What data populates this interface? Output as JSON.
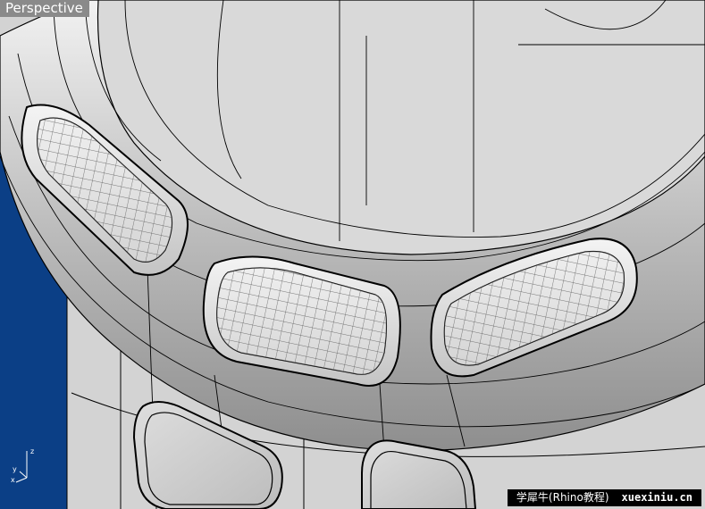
{
  "viewport": {
    "title": "Perspective"
  },
  "axis_widget": {
    "x_label": "x",
    "y_label": "y",
    "z_label": "z"
  },
  "watermark": {
    "text": "学犀牛(Rhino教程)",
    "site": "xuexiniu.cn"
  },
  "colors": {
    "background_plane": "#0b3f86",
    "model_fill": "#d8d8d8",
    "edge_lines": "#000000"
  }
}
